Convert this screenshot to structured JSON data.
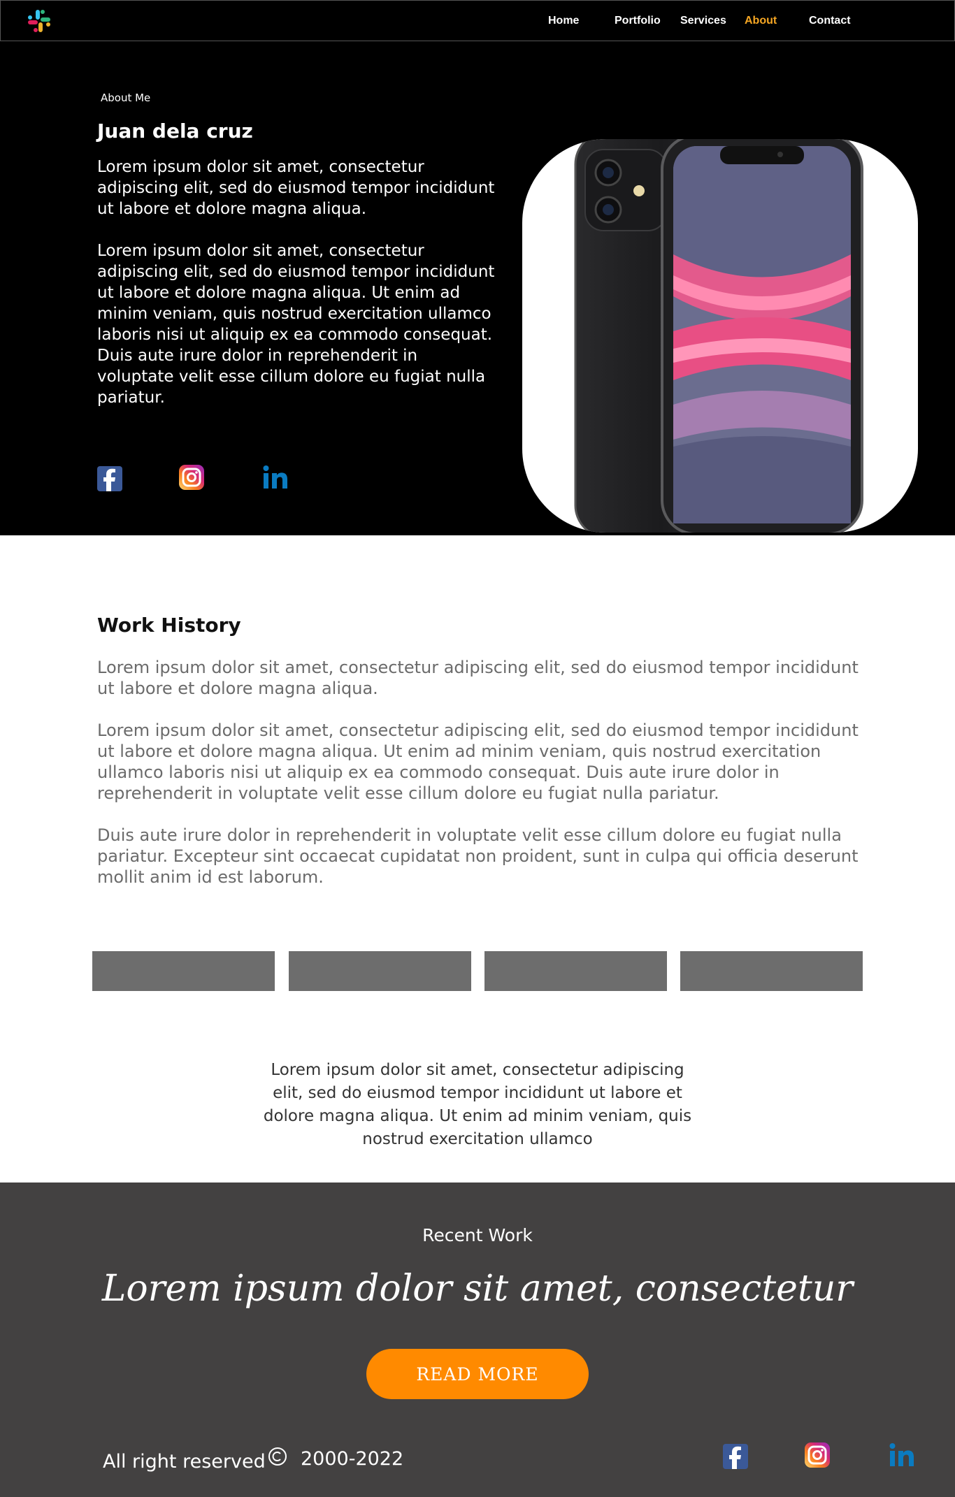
{
  "nav": {
    "items": [
      {
        "label": "Home",
        "active": false
      },
      {
        "label": "Portfolio",
        "active": false
      },
      {
        "label": "Services",
        "active": false
      },
      {
        "label": "About",
        "active": true
      },
      {
        "label": "Contact",
        "active": false
      }
    ],
    "active_color": "#f5a623"
  },
  "hero": {
    "eyebrow": "About Me",
    "name": "Juan dela cruz",
    "paragraph1": "Lorem ipsum dolor sit amet, consectetur adipiscing elit, sed do eiusmod tempor incididunt ut labore et dolore magna aliqua.",
    "paragraph2": "Lorem ipsum dolor sit amet, consectetur adipiscing elit, sed do eiusmod tempor incididunt ut labore et dolore magna aliqua. Ut enim ad minim veniam, quis nostrud exercitation ullamco laboris nisi ut aliquip ex ea commodo consequat. Duis aute irure dolor in reprehenderit in voluptate velit esse cillum dolore eu fugiat nulla pariatur.",
    "social_icons": [
      "facebook-icon",
      "instagram-icon",
      "linkedin-icon"
    ]
  },
  "work_history": {
    "title": "Work History",
    "paragraph1": "Lorem ipsum dolor sit amet, consectetur adipiscing elit, sed do eiusmod tempor incididunt ut labore et dolore magna aliqua.",
    "paragraph2": "Lorem ipsum dolor sit amet, consectetur adipiscing elit, sed do eiusmod tempor incididunt ut labore et dolore magna aliqua. Ut enim ad minim veniam, quis nostrud exercitation ullamco laboris nisi ut aliquip ex ea commodo consequat. Duis aute irure dolor in reprehenderit in voluptate velit esse cillum dolore eu fugiat nulla pariatur.",
    "paragraph3": "Duis aute irure dolor in reprehenderit in voluptate velit esse cillum dolore eu fugiat nulla pariatur. Excepteur sint occaecat cupidatat non proident, sunt in culpa qui officia deserunt mollit anim id est laborum.",
    "center_text": "Lorem ipsum dolor sit amet, consectetur adipiscing elit, sed do eiusmod tempor incididunt ut labore et dolore magna aliqua. Ut enim ad minim veniam, quis nostrud exercitation ullamco"
  },
  "footer": {
    "recent_label": "Recent Work",
    "tagline": "Lorem ipsum dolor sit amet, consectetur",
    "button_label": "READ MORE",
    "rights": "All right reserved",
    "years": "2000-2022",
    "button_color": "#ff8a00",
    "background": "#434141"
  }
}
